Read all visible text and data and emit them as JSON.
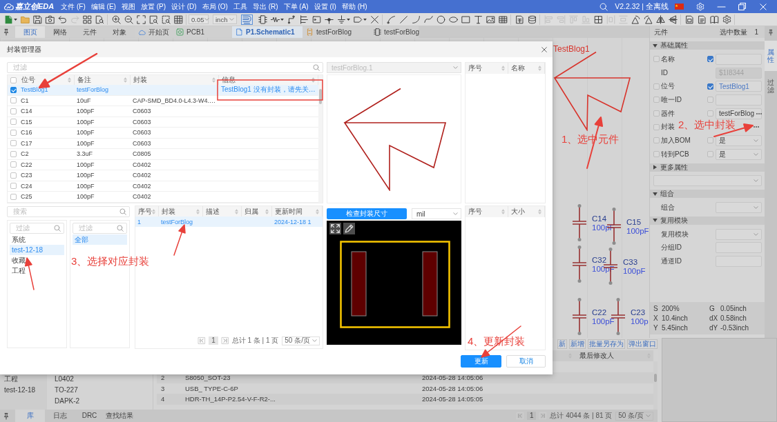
{
  "title_bar": {
    "logo": "嘉立创EDA",
    "menus": [
      "文件 (F)",
      "编辑 (E)",
      "视图",
      "放置 (P)",
      "设计 (D)",
      "布局 (O)",
      "工具",
      "导出 (R)",
      "下单 (A)",
      "设置 (I)",
      "帮助 (H)"
    ],
    "version": "V2.2.32 | 全离线"
  },
  "toolbar": {
    "left_groups": [
      [
        {
          "kind": "new-file",
          "disabled": false
        },
        {
          "kind": "folder",
          "disabled": false
        },
        {
          "kind": "save",
          "disabled": false
        },
        {
          "kind": "camera",
          "disabled": false
        },
        {
          "kind": "undo",
          "disabled": false
        },
        {
          "kind": "redo",
          "disabled": true
        },
        {
          "kind": "four-squares",
          "disabled": false
        },
        {
          "kind": "document-search",
          "disabled": false
        }
      ],
      [
        {
          "kind": "zoom-in",
          "disabled": false
        },
        {
          "kind": "zoom-out",
          "disabled": false
        },
        {
          "kind": "fit-screen",
          "disabled": false
        },
        {
          "kind": "zoom-window",
          "disabled": false
        },
        {
          "kind": "zoom-selection",
          "disabled": false
        },
        {
          "kind": "grid",
          "disabled": false
        }
      ]
    ],
    "grid_size": "0.05",
    "unit": "inch",
    "snap_on": true,
    "right_groups": [
      [
        {
          "kind": "chip",
          "disabled": false
        },
        {
          "kind": "resistor",
          "disabled": false
        },
        {
          "kind": "wire",
          "disabled": false
        },
        {
          "kind": "branch",
          "disabled": false
        },
        {
          "kind": "tag",
          "disabled": false
        },
        {
          "kind": "junction",
          "disabled": false
        },
        {
          "kind": "ground",
          "disabled": false
        },
        {
          "kind": "port",
          "disabled": false
        },
        {
          "kind": "cross",
          "disabled": false
        }
      ],
      [
        {
          "kind": "pen",
          "disabled": false
        },
        {
          "kind": "line",
          "disabled": false
        },
        {
          "kind": "arc",
          "disabled": false
        },
        {
          "kind": "curve",
          "disabled": false
        },
        {
          "kind": "circle",
          "disabled": false
        },
        {
          "kind": "ellipse",
          "disabled": false
        },
        {
          "kind": "rectangle",
          "disabled": false
        },
        {
          "kind": "text-tool",
          "disabled": false
        },
        {
          "kind": "image",
          "disabled": false
        },
        {
          "kind": "table",
          "disabled": false
        }
      ],
      [
        {
          "kind": "document",
          "disabled": false
        },
        {
          "kind": "database",
          "disabled": false
        }
      ],
      [
        {
          "kind": "align-left",
          "disabled": true
        },
        {
          "kind": "align-right",
          "disabled": true
        },
        {
          "kind": "align-top",
          "disabled": true
        },
        {
          "kind": "align-bottom",
          "disabled": true
        },
        {
          "kind": "grid-table",
          "disabled": false
        },
        {
          "kind": "distribute-h",
          "disabled": true
        },
        {
          "kind": "distribute-v",
          "disabled": true
        },
        {
          "kind": "rotate-left",
          "disabled": false
        },
        {
          "kind": "rotate-right",
          "disabled": false
        },
        {
          "kind": "flip-horizontal",
          "disabled": false
        },
        {
          "kind": "flip-vertical",
          "disabled": false
        }
      ],
      [
        {
          "kind": "document-box",
          "disabled": false
        },
        {
          "kind": "document-lines",
          "disabled": false
        },
        {
          "kind": "book",
          "disabled": false
        },
        {
          "kind": "gear",
          "disabled": false
        }
      ]
    ]
  },
  "left_panel": {
    "tabs": [
      {
        "label": "图页",
        "selected": true
      },
      {
        "label": "网络",
        "selected": false
      },
      {
        "label": "元件",
        "selected": false
      },
      {
        "label": "对象",
        "selected": false
      }
    ]
  },
  "document_tabs": [
    {
      "label": "开始页",
      "kind": "home",
      "selected": false
    },
    {
      "label": "PCB1",
      "kind": "pcb",
      "selected": false
    },
    {
      "label": "P1.Schematic1",
      "kind": "schematic",
      "selected": true
    },
    {
      "label": "testForBlog",
      "kind": "symbol",
      "selected": false
    },
    {
      "label": "testForBlog",
      "kind": "footprint",
      "selected": false
    }
  ],
  "canvas": {
    "symbol_label": "TestBlog1",
    "parts": [
      {
        "designator": "C14",
        "value": "100pF"
      },
      {
        "designator": "C15",
        "value": "100pF"
      },
      {
        "designator": "C32",
        "value": "100pF"
      },
      {
        "designator": "C33",
        "value": "100pF"
      },
      {
        "designator": "C22",
        "value": "100pF"
      },
      {
        "designator": "C23",
        "value": "100p"
      }
    ]
  },
  "properties": {
    "title": "元件",
    "selection_label": "选中数量",
    "selection_count": "1",
    "sections": [
      {
        "title": "基础属性",
        "expanded": true,
        "rows": [
          {
            "kind": "text",
            "label": "名称",
            "checked": false,
            "linked": true
          },
          {
            "kind": "id",
            "label": "ID",
            "value": "$1I8344"
          },
          {
            "kind": "text",
            "label": "位号",
            "checked": false,
            "linked": true,
            "value": "TestBlog1"
          },
          {
            "kind": "text",
            "label": "唯一ID",
            "checked": false,
            "linked": false
          },
          {
            "kind": "text",
            "label": "器件",
            "checked": false,
            "linked": false,
            "value": "testForBlog",
            "more": true
          },
          {
            "kind": "more",
            "label": "封装",
            "checked": false
          },
          {
            "kind": "select",
            "label": "加入BOM",
            "checked": false,
            "linked": false,
            "value": "是"
          },
          {
            "kind": "select",
            "label": "转到PCB",
            "checked": false,
            "linked": false,
            "value": "是"
          }
        ]
      },
      {
        "title": "更多属性",
        "expanded": false,
        "rows": [
          {
            "kind": "wide_select"
          }
        ]
      },
      {
        "title": "组合",
        "expanded": true,
        "rows": [
          {
            "kind": "plain_select",
            "label": "组合"
          }
        ]
      },
      {
        "title": "复用模块",
        "expanded": true,
        "rows": [
          {
            "kind": "plain_select",
            "label": "复用模块"
          },
          {
            "kind": "plain_text",
            "label": "分组ID"
          },
          {
            "kind": "plain_text",
            "label": "通道ID"
          }
        ]
      }
    ],
    "status": [
      {
        "label": "S",
        "value": "200%"
      },
      {
        "label": "G",
        "value": "0.05inch"
      },
      {
        "label": "X",
        "value": "10.4inch"
      },
      {
        "label": "dX",
        "value": "0.58inch"
      },
      {
        "label": "Y",
        "value": "5.45inch"
      },
      {
        "label": "dY",
        "value": "-0.53inch"
      }
    ]
  },
  "side_tabs": [
    {
      "label": "属性",
      "selected": true
    },
    {
      "label": "过滤",
      "selected": false
    }
  ],
  "bottom_panel": {
    "actions": [
      "新",
      "新增",
      "批量另存为",
      "弹出窗口"
    ],
    "modifier_column": "最后修改人",
    "categories": [
      "工程",
      "test-12-18"
    ],
    "footprints": [
      "L0402",
      "TO-227",
      "DAPK-2"
    ],
    "rows": [
      {
        "index": "2",
        "name": "S8050_SOT-23",
        "updated": "2024-05-28 14:05:06"
      },
      {
        "index": "3",
        "name": "USB_ TYPE-C-6P",
        "updated": "2024-05-28 14:05:06"
      },
      {
        "index": "4",
        "name": "HDR-TH_14P-P2.54-V-F-R2-...",
        "updated": "2024-05-28 14:05:05"
      }
    ],
    "pager": {
      "page": "1",
      "summary": "总计 4044 条 | 81 页",
      "page_size": "50 条/页"
    },
    "tabs": [
      {
        "label": "库",
        "selected": true
      },
      {
        "label": "日志",
        "selected": false
      },
      {
        "label": "DRC",
        "selected": false
      },
      {
        "label": "查找结果",
        "selected": false
      }
    ]
  },
  "dialog": {
    "title": "封装管理器",
    "components": {
      "filter_placeholder": "过滤",
      "all_checked": false,
      "columns": [
        "位号",
        "备注",
        "封装",
        "信息"
      ],
      "rows": [
        {
          "designator": "TestBlog1",
          "note": "testForBlog",
          "info": "TestBlog1 没有封装，请先关…",
          "checked": true,
          "selected": true
        },
        {
          "designator": "C1",
          "note": "10uF",
          "footprint": "CAP-SMD_BD4.0-L4.3-W4.…",
          "checked": false,
          "selected": false
        },
        {
          "designator": "C14",
          "note": "100pF",
          "footprint": "C0603",
          "checked": false,
          "selected": false
        },
        {
          "designator": "C15",
          "note": "100pF",
          "footprint": "C0603",
          "checked": false,
          "selected": false
        },
        {
          "designator": "C16",
          "note": "100pF",
          "footprint": "C0603",
          "checked": false,
          "selected": false
        },
        {
          "designator": "C17",
          "note": "100pF",
          "footprint": "C0603",
          "checked": false,
          "selected": false
        },
        {
          "designator": "C2",
          "note": "3.3uF",
          "footprint": "C0805",
          "checked": false,
          "selected": false
        },
        {
          "designator": "C22",
          "note": "100pF",
          "footprint": "C0402",
          "checked": false,
          "selected": false
        },
        {
          "designator": "C23",
          "note": "100pF",
          "footprint": "C0402",
          "checked": false,
          "selected": false
        },
        {
          "designator": "C24",
          "note": "100pF",
          "footprint": "C0402",
          "checked": false,
          "selected": false
        },
        {
          "designator": "C25",
          "note": "100pF",
          "footprint": "C0402",
          "checked": false,
          "selected": false
        }
      ]
    },
    "library": {
      "search_placeholder": "搜索",
      "categories": {
        "filter_placeholder": "过滤",
        "items": [
          {
            "label": "系统",
            "selected": false
          },
          {
            "label": "test-12-18",
            "selected": true
          },
          {
            "label": "收藏",
            "selected": false
          },
          {
            "label": "工程",
            "selected": false
          }
        ]
      },
      "subcategories": {
        "filter_placeholder": "过滤",
        "items": [
          {
            "label": "全部",
            "selected": true
          }
        ]
      },
      "results": {
        "columns": [
          "序号",
          "封装",
          "描述",
          "归属",
          "更新时间"
        ],
        "rows": [
          {
            "index": "1",
            "footprint": "testForBlog",
            "updated": "2024-12-18 1",
            "selected": true
          }
        ],
        "pager": {
          "page": "1",
          "summary": "总计 1 条 | 1 页",
          "page_size": "50 条/页"
        }
      }
    },
    "symbol": {
      "selector": "testForBlog.1",
      "selector_disabled": true
    },
    "footprint": {
      "check_button": "检查封装尺寸",
      "unit": "mil"
    },
    "pins_table": {
      "columns": [
        "序号",
        "名称"
      ]
    },
    "pads_table": {
      "columns": [
        "序号",
        "大小"
      ]
    },
    "buttons": [
      {
        "label": "更新",
        "kind": "primary"
      },
      {
        "label": "取消",
        "kind": "secondary"
      }
    ]
  },
  "annotations": [
    "1、选中元件",
    "2、选中封装",
    "3、选择对应封装",
    "4、更新封装"
  ]
}
